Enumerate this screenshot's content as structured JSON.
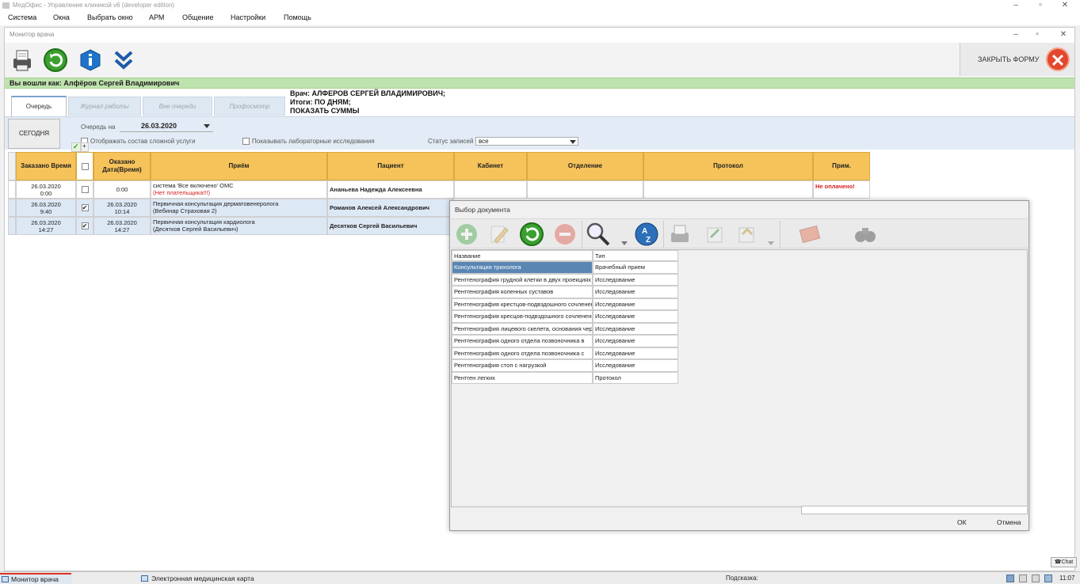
{
  "app": {
    "title": "МедОфис - Управление клиникой v6 (developer edition)",
    "menu": [
      "Система",
      "Окна",
      "Выбрать окно",
      "АРМ",
      "Общение",
      "Настройки",
      "Помощь"
    ]
  },
  "child_window": {
    "title": "Монитор врача",
    "close_form_label": "ЗАКРЫТЬ ФОРМУ",
    "toolbar_icons": [
      "printer-icon",
      "refresh-icon",
      "info-icon",
      "double-chevron-down-icon"
    ]
  },
  "login": {
    "text": "Вы вошли как: Алфёров Сергей Владимирович"
  },
  "tabs": [
    {
      "label": "Очередь",
      "active": true
    },
    {
      "label": "Журнал работы",
      "active": false
    },
    {
      "label": "Вне очереди",
      "active": false
    },
    {
      "label": "Профосмотр",
      "active": false
    }
  ],
  "doctor_info": {
    "line1": "Врач: АЛФЕРОВ СЕРГЕЙ ВЛАДИМИРОВИЧ;",
    "line2": "Итоги:  ПО ДНЯМ;",
    "line3": "ПОКАЗАТЬ СУММЫ"
  },
  "filters": {
    "today_button": "СЕГОДНЯ",
    "queue_date_label": "Очередь на",
    "queue_date": "26.03.2020",
    "show_complex_label": "Отображать состав сложной услуги",
    "show_lab_label": "Показывать лабораторные исследования",
    "status_label": "Статус записей",
    "status_value": "все"
  },
  "grid": {
    "columns": [
      "Заказано Время",
      "",
      "Оказано Дата(Время)",
      "Приём",
      "Пациент",
      "Кабинет",
      "Отделение",
      "Протокол",
      "Прим."
    ],
    "rows": [
      {
        "ordered_date": "26.03.2020",
        "ordered_time": "0:00",
        "checked": false,
        "done": "0:00",
        "reception1": "система 'Все включено' ОМС",
        "reception2": "(Нет плательщика!!!)",
        "reception2_red": true,
        "patient": "Ананьева Надежда Алексеевна",
        "note": "Не оплачено!"
      },
      {
        "ordered_date": "26.03.2020",
        "ordered_time": "9:40",
        "checked": true,
        "done": "26.03.2020 10:14",
        "done_date": "26.03.2020",
        "done_time": "10:14",
        "reception1": "Первичная консультация дерматовенеролога",
        "reception2": "(Вебинар Страховая 2)",
        "reception2_red": false,
        "patient": "Романов Алексей Александрович",
        "note": ""
      },
      {
        "ordered_date": "26.03.2020",
        "ordered_time": "14:27",
        "checked": true,
        "done": "26.03.2020 14:27",
        "done_date": "26.03.2020",
        "done_time": "14:27",
        "reception1": "Первичная консультация кардиолога",
        "reception2": "(Десятков Сергей Васильевич)",
        "reception2_red": false,
        "patient": "Десятков Сергей Васильевич",
        "note": ""
      }
    ]
  },
  "dialog": {
    "title": "Выбор документа",
    "toolbar_icons": [
      "add-icon",
      "edit-icon",
      "refresh-icon",
      "delete-icon",
      "search-icon",
      "sort-az-icon",
      "print-icon",
      "export-icon",
      "import-icon",
      "template-icon",
      "binoculars-icon"
    ],
    "columns": [
      "Название",
      "Тип"
    ],
    "rows": [
      {
        "name": "Консультация трихолога",
        "type": "Врачебный  прием",
        "selected": true
      },
      {
        "name": "Рентгенография грудной клетки в двух проекциях",
        "type": "Исследование",
        "selected": false
      },
      {
        "name": "Рентгенография коленных суставов",
        "type": "Исследование",
        "selected": false
      },
      {
        "name": "Рентгенография крестцов-подвздошного сочленения",
        "type": "Исследование",
        "selected": false
      },
      {
        "name": "Рентгенография кресцов-подвздошного сочленения",
        "type": "Исследование",
        "selected": false
      },
      {
        "name": "Рентгенография лицевого скелета, основания черепа",
        "type": "Исследование",
        "selected": false
      },
      {
        "name": "Рентгенография одного отдела позвоночника в",
        "type": "Исследование",
        "selected": false
      },
      {
        "name": "Рентгенография одного отдела позвоночника с",
        "type": "Исследование",
        "selected": false
      },
      {
        "name": "Рентгенография стоп с нагрузкой",
        "type": "Исследование",
        "selected": false
      },
      {
        "name": "Рентген легких",
        "type": "Протокол",
        "selected": false
      }
    ],
    "ok": "ОК",
    "cancel": "Отмена"
  },
  "taskbar": {
    "item1": "Монитор врача",
    "item2": "Электронная медицинская карта",
    "hint_label": "Подсказка:",
    "chat": "Chat",
    "clock": "11:07"
  }
}
